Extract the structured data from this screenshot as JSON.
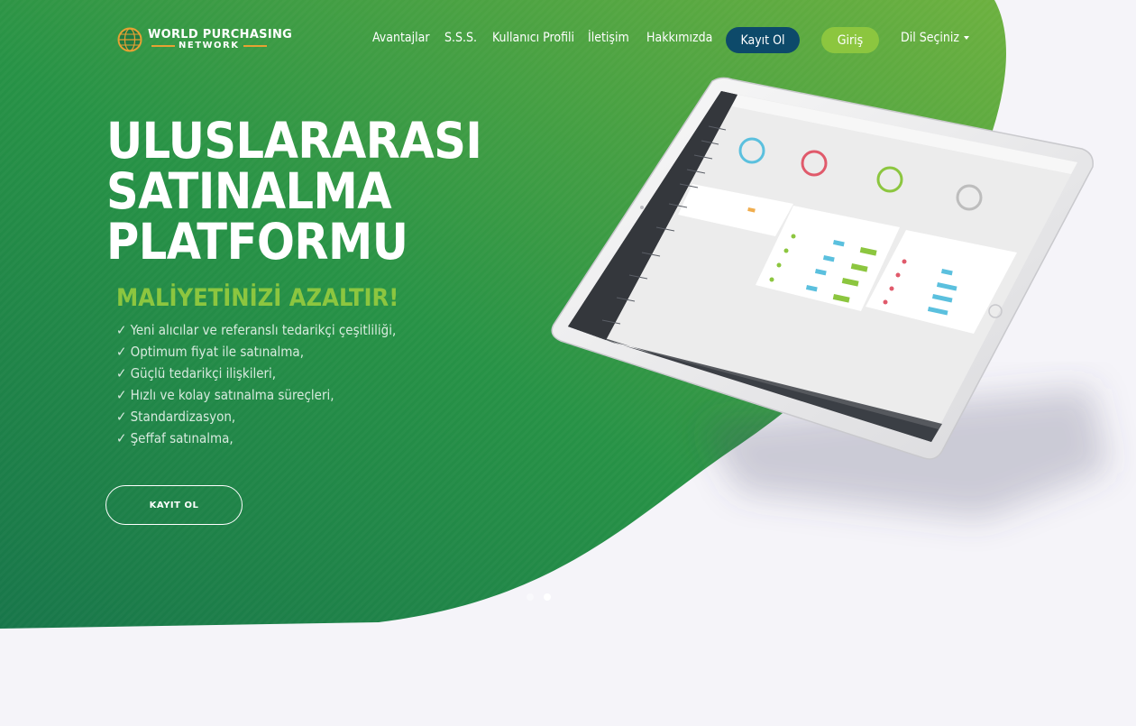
{
  "brand": {
    "line1": "WORLD PURCHASING",
    "line2": "NETWORK"
  },
  "nav": {
    "items": [
      "Avantajlar",
      "S.S.S.",
      "Kullanıcı Profili",
      "İletişim",
      "Hakkımızda"
    ],
    "register_label": "Kayıt Ol",
    "login_label": "Giriş",
    "language_label": "Dil Seçiniz"
  },
  "hero": {
    "title_lines": [
      "ULUSLARARASI",
      "SATINALMA",
      "PLATFORMU"
    ],
    "subtitle": "MALİYETİNİZİ AZALTIR!",
    "benefits": [
      "✓ Yeni alıcılar ve referanslı tedarikçi çeşitliliği,",
      "✓ Optimum fiyat ile satınalma,",
      "✓ Güçlü tedarikçi ilişkileri,",
      "✓ Hızlı ve kolay satınalma süreçleri,",
      "✓ Standardizasyon,",
      "✓ Şeffaf satınalma,"
    ],
    "cta_label": "KAYIT OL"
  },
  "carousel": {
    "slide_count": 2,
    "active_slide": 2
  },
  "colors": {
    "hero_green_dark": "#1c8449",
    "hero_green_light": "#6cb33f",
    "accent_green": "#8cc63f",
    "register_navy": "#0d4a6a",
    "logo_gold": "#e7a133",
    "page_background": "#f5f4f9"
  }
}
